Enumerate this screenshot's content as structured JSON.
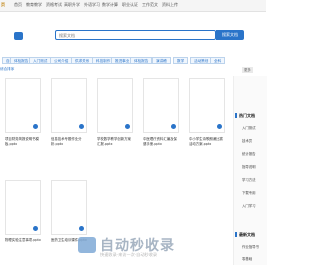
{
  "nav": {
    "items": [
      "页",
      "首页",
      "教育教学",
      "资格考试",
      "高职升学",
      "外语学习",
      "数学计算",
      "职业认证",
      "工作范文",
      "资料上传"
    ],
    "active_index": 0
  },
  "search": {
    "placeholder": "搜索文档",
    "button": "搜索文档"
  },
  "tags": [
    "自动",
    "体检报告",
    "入门测试",
    "公司介绍",
    "供求关系",
    "科技制作",
    "推进事业",
    "体检报告",
    "演讲稿",
    "数学",
    "活动策划",
    "全科"
  ],
  "more": "更多",
  "sort": "综合排序",
  "cards": [
    {
      "title": "项目财务简报说明书模板.pptx"
    },
    {
      "title": "信息技术专题作业分析.pptx"
    },
    {
      "title": "学校数学教学创新方案汇报.pptx"
    },
    {
      "title": "中医理疗资料汇编及保健手册.pptx"
    },
    {
      "title": "中小学生诗歌朗诵比赛活动方案.pptx"
    },
    {
      "title": "物理实验注意事项.pptx"
    },
    {
      "title": "医药卫生培训课件.pptx"
    }
  ],
  "sidebar": {
    "hot_title": "热门文档",
    "hot_items": [
      "入门测试",
      "技术员",
      "统计报告",
      "指导说明",
      "学习方法",
      "下载专用",
      "入门学习"
    ],
    "new_title": "最新文档",
    "new_items": [
      "作业指导书",
      "零基础"
    ]
  },
  "watermark": {
    "brand": "自动秒收录",
    "sub": "快速收录·来访一次·自动秒收录"
  },
  "colors": {
    "accent": "#2a74c9",
    "nav_active": "#c48a1b"
  }
}
